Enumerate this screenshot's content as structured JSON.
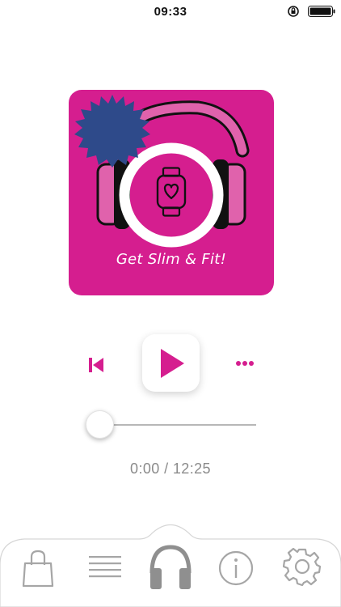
{
  "status_bar": {
    "time": "09:33"
  },
  "album": {
    "caption": "Get Slim & Fit!"
  },
  "player": {
    "elapsed": "0:00",
    "duration": "12:25",
    "time_display": "0:00 / 12:25",
    "progress": 0
  },
  "tabs": [
    {
      "icon": "shopping-bag-icon"
    },
    {
      "icon": "list-icon"
    },
    {
      "icon": "headphones-icon",
      "active": true
    },
    {
      "icon": "info-icon"
    },
    {
      "icon": "gear-icon"
    }
  ],
  "colors": {
    "accent": "#d51e8f",
    "badge": "#2e4a8a",
    "tab_icon": "#a6a6a6"
  }
}
